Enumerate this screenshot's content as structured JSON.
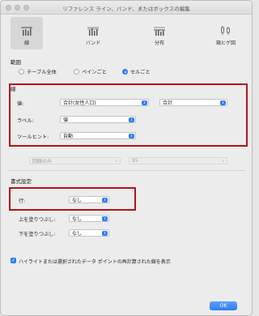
{
  "window": {
    "title": "リファレンス ライン、バンド、またはボックスの編集"
  },
  "tabs": [
    {
      "label": "線",
      "icon": "line-icon",
      "active": true
    },
    {
      "label": "バンド",
      "icon": "band-icon",
      "active": false
    },
    {
      "label": "分布",
      "icon": "distribution-icon",
      "active": false
    },
    {
      "label": "箱ヒゲ図",
      "icon": "boxplot-icon",
      "active": false
    }
  ],
  "scope": {
    "label": "範囲",
    "options": [
      {
        "label": "テーブル全体",
        "selected": false
      },
      {
        "label": "ペインごと",
        "selected": false
      },
      {
        "label": "セルごと",
        "selected": true
      }
    ]
  },
  "line_section": {
    "label": "線",
    "value_label": "値:",
    "value_field": "合計(女性人口)",
    "value_agg": "合計",
    "label_label": "ラベル:",
    "label_value": "値",
    "tooltip_label": "ツールヒント:",
    "tooltip_value": "自動"
  },
  "disabled_row": {
    "field1": "回線のみ",
    "field2": "95"
  },
  "format": {
    "label": "書式設定",
    "line_label": "行:",
    "line_value": "なし",
    "fill_above_label": "上を塗りつぶし:",
    "fill_above_value": "なし",
    "fill_below_label": "下を塗りつぶし:",
    "fill_below_value": "なし"
  },
  "recalc": {
    "checked": true,
    "label": "ハイライトまたは選択されたデータ ポイントの再計算された線を表示"
  },
  "ok_label": "OK",
  "colors": {
    "accent": "#2f7cf6",
    "highlight_box": "#b3131b"
  }
}
